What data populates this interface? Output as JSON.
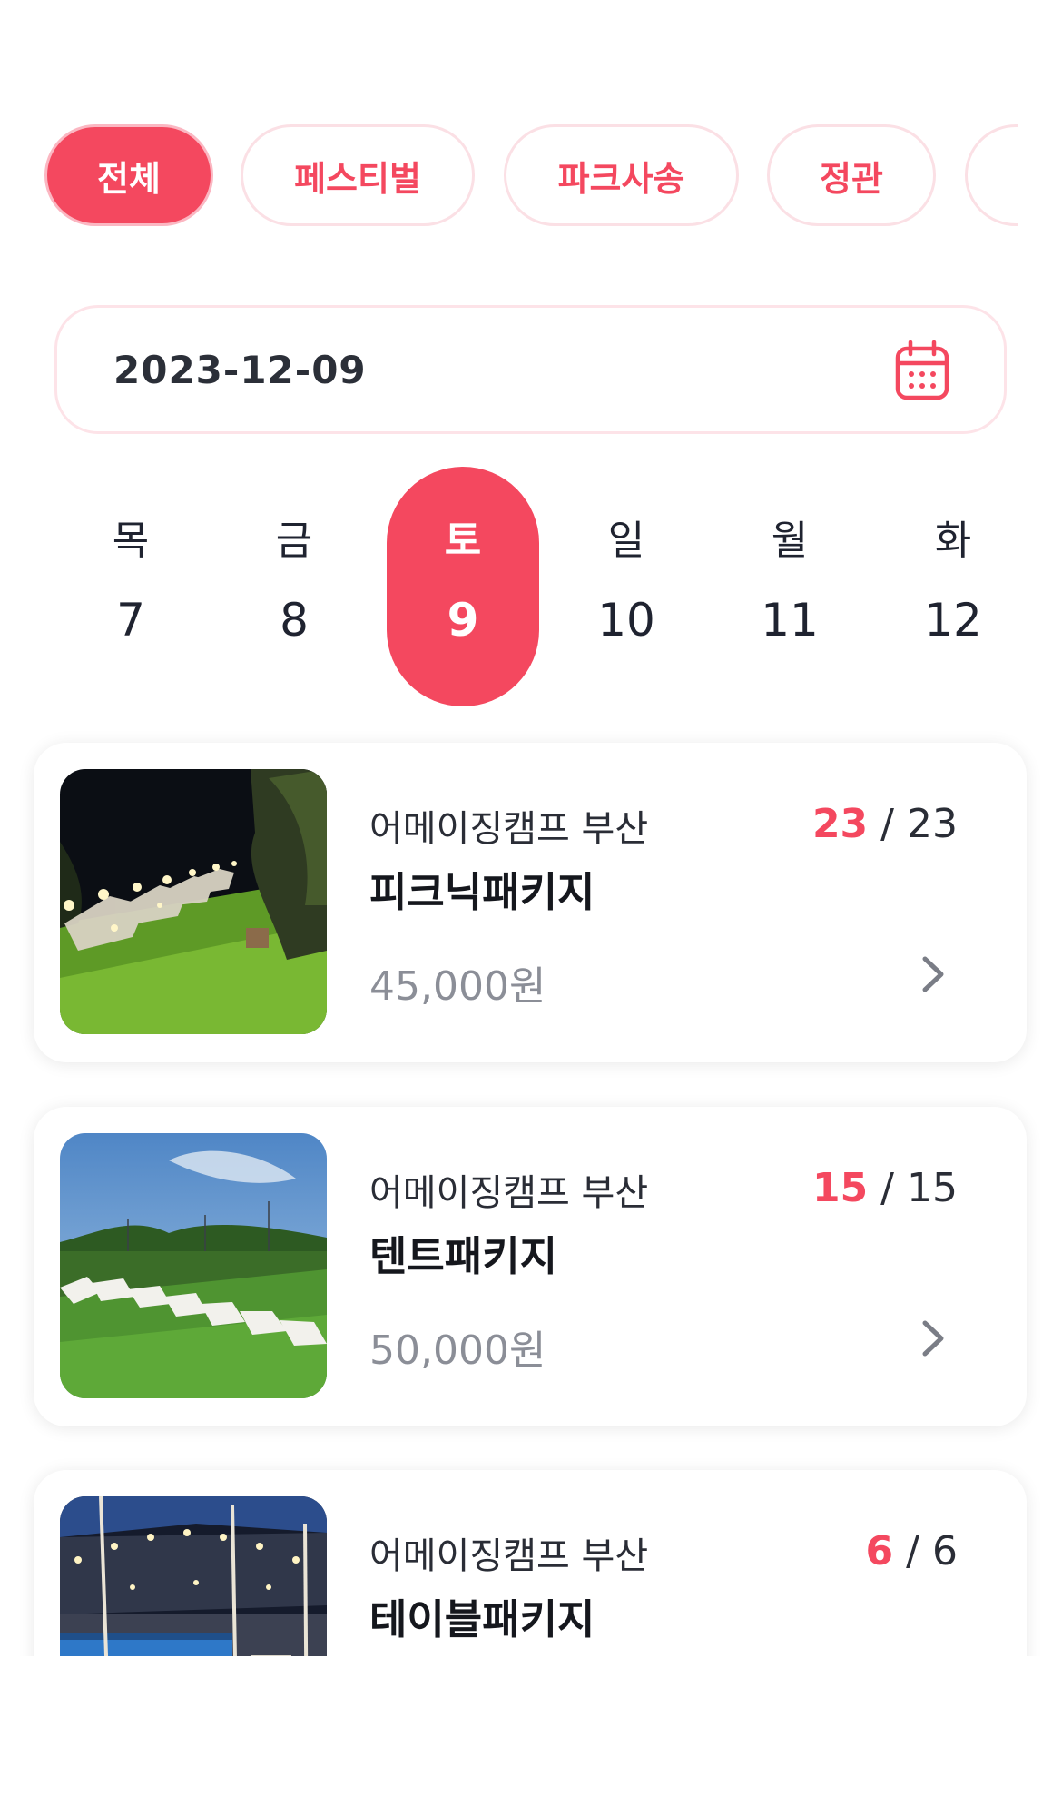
{
  "categories": [
    {
      "label": "전체",
      "active": true
    },
    {
      "label": "페스티벌",
      "active": false
    },
    {
      "label": "파크사송",
      "active": false
    },
    {
      "label": "정관",
      "active": false
    },
    {
      "label": "",
      "active": false
    }
  ],
  "date_field": {
    "value": "2023-12-09"
  },
  "week": [
    {
      "weekday": "목",
      "day": "7"
    },
    {
      "weekday": "금",
      "day": "8"
    },
    {
      "weekday": "토",
      "day": "9",
      "selected": true
    },
    {
      "weekday": "일",
      "day": "10"
    },
    {
      "weekday": "월",
      "day": "11"
    },
    {
      "weekday": "화",
      "day": "12"
    }
  ],
  "products": [
    {
      "venue": "어메이징캠프 부산",
      "name": "피크닉패키지",
      "price": "45,000원",
      "available": "23",
      "separator": "/",
      "total": "23"
    },
    {
      "venue": "어메이징캠프 부산",
      "name": "텐트패키지",
      "price": "50,000원",
      "available": "15",
      "separator": "/",
      "total": "15"
    },
    {
      "venue": "어메이징캠프 부산",
      "name": "테이블패키지",
      "price": "",
      "available": "6",
      "separator": "/",
      "total": "6"
    }
  ],
  "colors": {
    "accent": "#f4485f",
    "chip_border": "#fbe0e5",
    "muted": "#8b8e97"
  },
  "icons": {
    "date": "calendar-icon",
    "card_link": "chevron-right-icon"
  }
}
